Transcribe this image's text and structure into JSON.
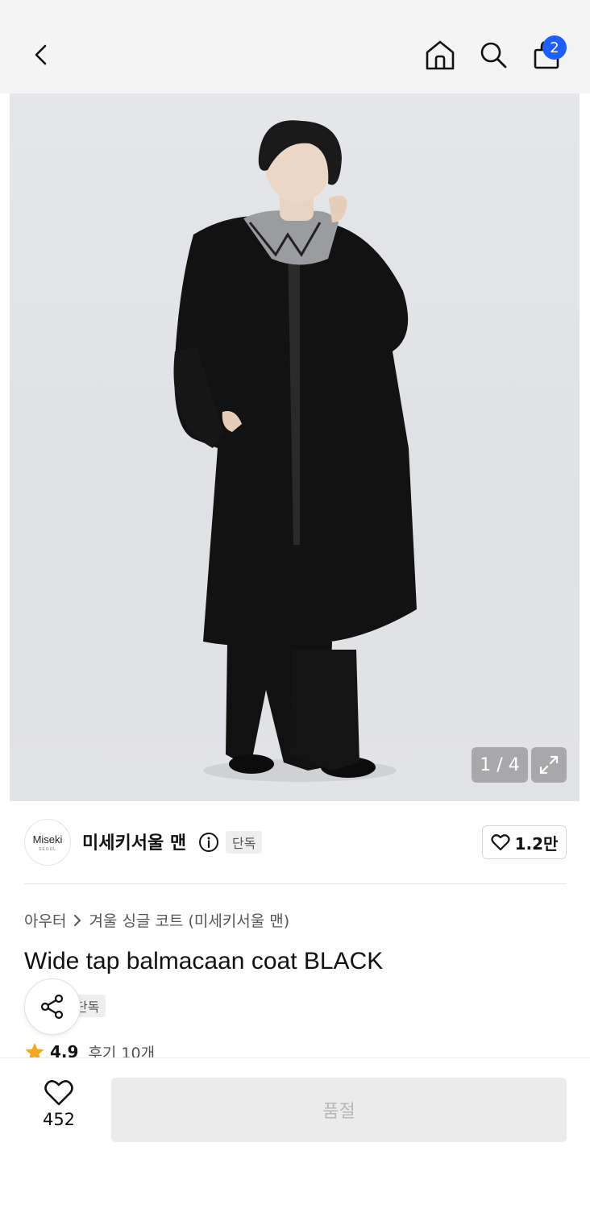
{
  "header": {
    "back_icon": "chevron-left-icon",
    "home_icon": "home-icon",
    "search_icon": "search-icon",
    "cart_icon": "shopping-bag-icon",
    "cart_badge": "2",
    "badge_color": "#1f5eff"
  },
  "gallery": {
    "counter": "1 / 4",
    "expand_icon": "expand-icon",
    "background_color": "#e2e3e6"
  },
  "brand": {
    "logo_line1": "Miseki",
    "logo_line2": "SEOUL",
    "name": "미세키서울 맨",
    "tag": "단독",
    "like_count": "1.2만"
  },
  "product": {
    "breadcrumb": [
      "아우터",
      "겨울 싱글 코트 (미세키서울 맨)"
    ],
    "title": "Wide tap balmacaan coat BLACK",
    "tag": "단독",
    "rating": "4.9",
    "review_label": "후기 10개",
    "star_color": "#f5a623"
  },
  "bottom": {
    "wish_count": "452",
    "soldout_label": "품절"
  }
}
